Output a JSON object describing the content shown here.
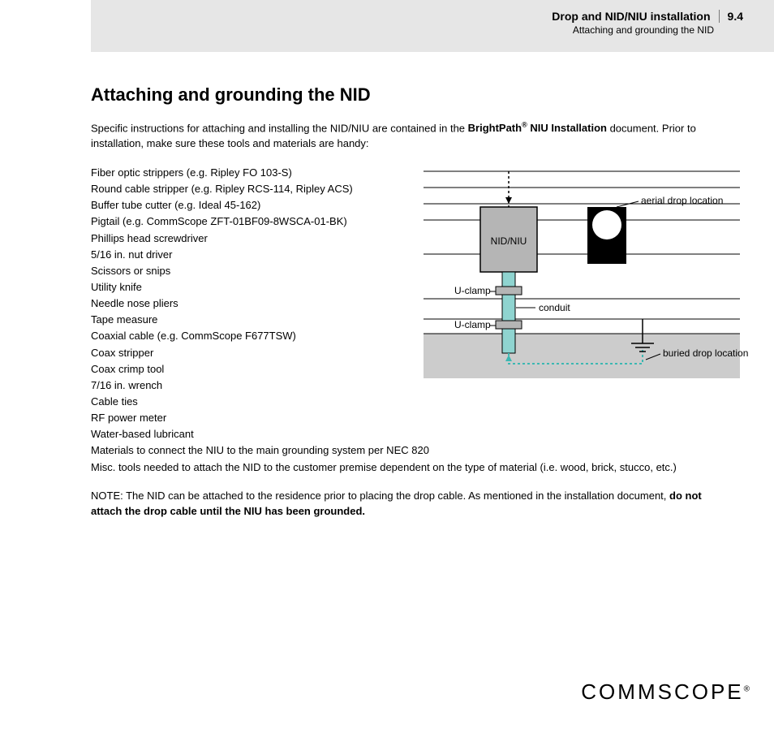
{
  "header": {
    "chapter_title": "Drop and NID/NIU installation",
    "section_number": "9.4",
    "section_title": "Attaching and grounding the NID"
  },
  "heading": "Attaching and grounding the NID",
  "intro": {
    "text_before_bold": "Specific instructions for attaching and installing the NID/NIU are contained in the ",
    "bold_label": "BrightPath",
    "bold_suffix": " NIU Installation",
    "text_after_bold": " document. Prior to installation, make sure these tools and materials are handy:"
  },
  "tools": [
    "Fiber optic strippers (e.g. Ripley FO 103-S)",
    "Round cable stripper (e.g. Ripley RCS-114, Ripley ACS)",
    "Buffer tube cutter (e.g. Ideal 45-162)",
    "Pigtail (e.g. CommScope ZFT-01BF09-8WSCA-01-BK)",
    "Phillips head screwdriver",
    "5/16 in. nut driver",
    "Scissors or snips",
    "Utility knife",
    "Needle nose pliers",
    "Tape measure",
    "Coaxial cable (e.g. CommScope F677TSW)",
    "Coax stripper",
    "Coax crimp tool",
    "7/16 in. wrench",
    "Cable ties",
    "RF power meter",
    "Water-based lubricant"
  ],
  "tools_wide": [
    "Materials to connect the NIU to the main grounding system per NEC 820",
    "Misc. tools needed to attach the NID to the customer premise dependent on the type of material (i.e. wood, brick, stucco, etc.)"
  ],
  "note": {
    "prefix": "NOTE: The NID can be attached to the residence prior to placing the drop cable. As mentioned in the installation document, ",
    "bold": "do not attach the drop cable until the NIU has been grounded."
  },
  "diagram": {
    "nid_label": "NID/NIU",
    "aerial_label": "aerial drop location",
    "uclamp_label": "U-clamp",
    "conduit_label": "conduit",
    "buried_label": "buried drop location"
  },
  "logo_text": "COMMSCOPE"
}
